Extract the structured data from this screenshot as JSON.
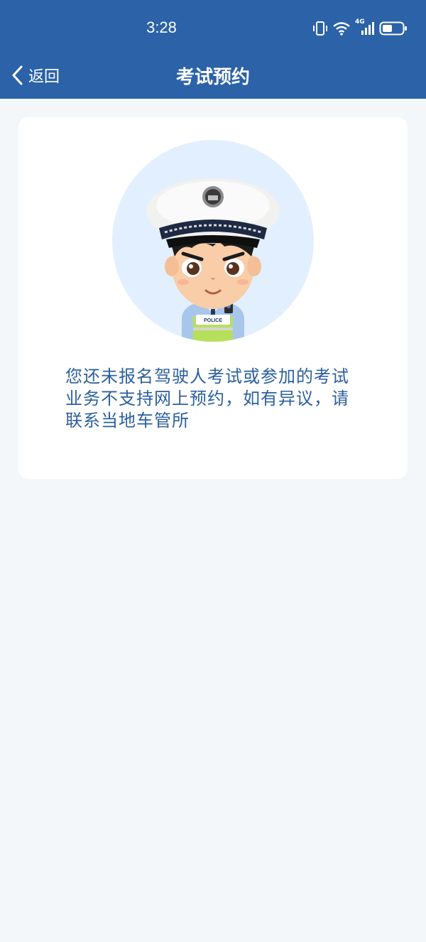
{
  "status_bar": {
    "time": "3:28",
    "network_label": "4G",
    "icons": [
      "vibrate-icon",
      "wifi-icon",
      "signal-icon",
      "battery-icon"
    ]
  },
  "nav": {
    "back_label": "返回",
    "title": "考试预约"
  },
  "card": {
    "illustration": "police-officer-cartoon",
    "badge_text": "POLICE",
    "message": "您还未报名驾驶人考试或参加的考试业务不支持网上预约，如有异议，请联系当地车管所"
  },
  "colors": {
    "header": "#2b62a8",
    "background": "#f3f7fa",
    "card": "#ffffff",
    "message_text": "#2b5f9e",
    "illustration_bg": "#e2effe"
  }
}
